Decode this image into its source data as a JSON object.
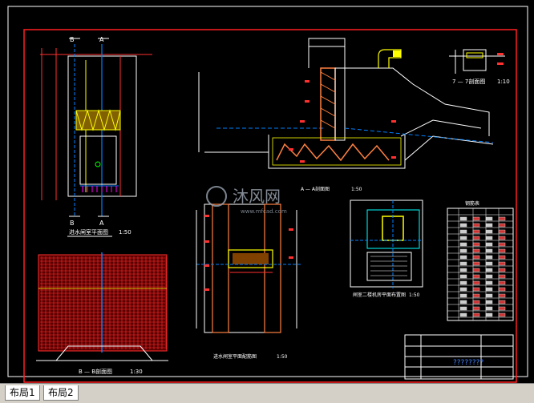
{
  "drawing": {
    "titles": {
      "bb_section_top_left_b": "B",
      "bb_section_top_left_a": "A",
      "plan_title": "进水闸室平面图",
      "plan_scale": "1:50",
      "bb_section_title": "B  —  B剖面图",
      "bb_section_scale": "1:30",
      "aa_section_title": "A  —  A剖面图",
      "aa_section_scale": "1:50",
      "rebar_plan_title": "进水闸室平面配筋图",
      "rebar_plan_scale": "1:50",
      "gate_floor_title": "闸室二楼机房平面布置图",
      "gate_floor_scale": "1:50",
      "detail_77_title": "7  —  7剖面图",
      "detail_77_scale": "1:10",
      "plan_label_b": "B",
      "plan_label_a": "A",
      "watermark": "沐风网",
      "watermark_url": "www.mfcad.com"
    },
    "title_block_text": "????????",
    "table_title": "钢筋表"
  },
  "tabs": [
    {
      "label": "布局1"
    },
    {
      "label": "布局2"
    }
  ],
  "colors": {
    "background": "#000000",
    "frame": "#ff0000",
    "structure": "#ffffff",
    "rebar_red": "#ff3030",
    "rebar_yellow": "#ffff00",
    "water": "#0080ff",
    "hatch_orange": "#ff8040",
    "cyan": "#00ffff",
    "magenta": "#ff00ff"
  }
}
